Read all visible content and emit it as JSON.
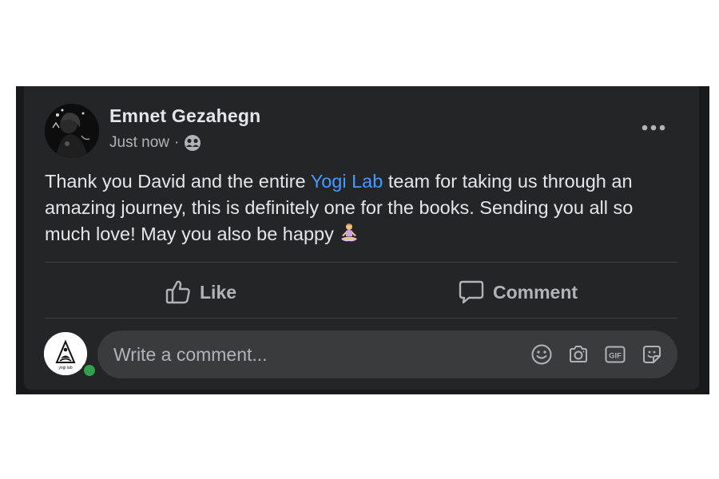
{
  "post": {
    "author": "Emnet Gezahegn",
    "timestamp": "Just now",
    "separator": "·",
    "privacy_icon": "friends-icon",
    "text_before": "Thank you David and the entire ",
    "mention": "Yogi Lab",
    "text_after": " team for taking us through an amazing journey, this is definitely one for the books. Sending you all so much love! May you also be happy",
    "emoji": "person-in-lotus-position"
  },
  "actions": {
    "like_label": "Like",
    "comment_label": "Comment"
  },
  "comment_box": {
    "placeholder": "Write a comment...",
    "commenter_logo_text": "yogi lab",
    "icons": [
      "emoji-icon",
      "camera-icon",
      "gif-icon",
      "sticker-icon"
    ],
    "gif_label": "GIF"
  },
  "colors": {
    "card_bg": "#242526",
    "text": "#e4e6eb",
    "secondary_text": "#b0b3b8",
    "link": "#4599ff",
    "online": "#31a24c"
  }
}
